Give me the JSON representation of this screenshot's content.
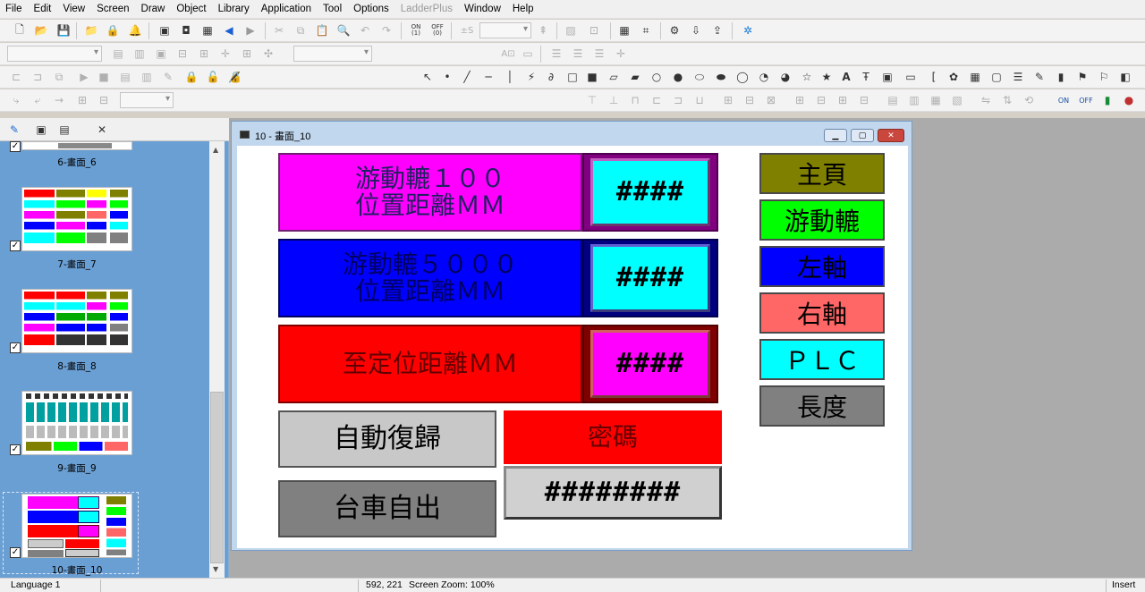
{
  "menu": [
    "File",
    "Edit",
    "View",
    "Screen",
    "Draw",
    "Object",
    "Library",
    "Application",
    "Tool",
    "Options",
    "LadderPlus",
    "Window",
    "Help"
  ],
  "toolbar": {
    "onoff_on": "ON",
    "onoff_off": "OFF",
    "onoff2_on": "ON",
    "onoff2_off": "OFF"
  },
  "pages": [
    {
      "label": "6-畫面_6",
      "checked": true
    },
    {
      "label": "7-畫面_7",
      "checked": true
    },
    {
      "label": "8-畫面_8",
      "checked": true
    },
    {
      "label": "9-畫面_9",
      "checked": true
    },
    {
      "label": "10-畫面_10",
      "checked": true,
      "selected": true
    }
  ],
  "window": {
    "title": "10 - 畫面_10"
  },
  "screen": {
    "block1": {
      "line1": "游動轆１００",
      "line2": "位置距離ＭＭ",
      "value": "####",
      "bg": "#ff00ff",
      "value_bg": "#00ffff"
    },
    "block2": {
      "line1": "游動轆５０００",
      "line2": "位置距離ＭＭ",
      "value": "####",
      "bg": "#0000ff",
      "value_bg": "#00ffff"
    },
    "block3": {
      "line1": "至定位距離ＭＭ",
      "value": "####",
      "bg": "#ff0000",
      "value_bg": "#ff00ff"
    },
    "auto_return": "自動復歸",
    "cart_out": "台車自出",
    "password_label": "密碼",
    "password_value": "########",
    "nav": [
      {
        "label": "主頁",
        "bg": "#808000"
      },
      {
        "label": "游動轆",
        "bg": "#00ff00"
      },
      {
        "label": "左軸",
        "bg": "#0000ff"
      },
      {
        "label": "右軸",
        "bg": "#ff6666"
      },
      {
        "label": "ＰＬＣ",
        "bg": "#00ffff"
      },
      {
        "label": "長度",
        "bg": "#808080"
      }
    ]
  },
  "status": {
    "language": "Language 1",
    "coords": "592, 221",
    "zoom": "Screen Zoom: 100%",
    "mode": "Insert"
  }
}
